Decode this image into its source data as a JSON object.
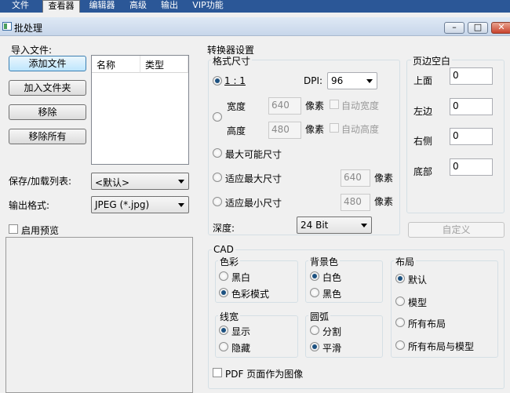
{
  "menu": {
    "items": [
      "文件",
      "查看器",
      "编辑器",
      "高级",
      "输出",
      "VIP功能"
    ],
    "active_index": 1
  },
  "window": {
    "title": "批处理",
    "min": "–",
    "max": "□",
    "close": "✕"
  },
  "import": {
    "label": "导入文件:",
    "add_files": "添加文件",
    "add_folder": "加入文件夹",
    "remove": "移除",
    "remove_all": "移除所有",
    "columns": [
      "名称",
      "类型"
    ]
  },
  "save_load": {
    "label": "保存/加载列表:",
    "value": "<默认>"
  },
  "output_format": {
    "label": "输出格式:",
    "value": "JPEG (*.jpg)"
  },
  "preview": {
    "label": "启用预览",
    "checked": false
  },
  "converter": {
    "title": "转换器设置",
    "format_size": {
      "title": "格式尺寸",
      "one_to_one": "1 : 1",
      "dpi_label": "DPI:",
      "dpi_value": "96",
      "width_label": "宽度",
      "width_value": "640",
      "height_label": "高度",
      "height_value": "480",
      "pixel_label": "像素",
      "auto_width": "自动宽度",
      "auto_height": "自动高度",
      "max_possible": "最大可能尺寸",
      "fit_max": "适应最大尺寸",
      "fit_max_value": "640",
      "fit_min": "适应最小尺寸",
      "fit_min_value": "480",
      "depth_label": "深度:",
      "depth_value": "24 Bit"
    },
    "margins": {
      "title": "页边空白",
      "top_label": "上面",
      "top_value": "0",
      "left_label": "左边",
      "left_value": "0",
      "right_label": "右侧",
      "right_value": "0",
      "bottom_label": "底部",
      "bottom_value": "0",
      "custom": "自定义"
    },
    "cad": {
      "title": "CAD",
      "color": {
        "title": "色彩",
        "bw": "黑白",
        "color_mode": "色彩模式",
        "selected": "color_mode"
      },
      "background": {
        "title": "背景色",
        "white": "白色",
        "black": "黑色",
        "selected": "white"
      },
      "layout": {
        "title": "布局",
        "default": "默认",
        "model": "模型",
        "all_layouts": "所有布局",
        "all_layouts_model": "所有布局与模型",
        "selected": "default"
      },
      "line_width": {
        "title": "线宽",
        "show": "显示",
        "hide": "隐藏",
        "selected": "show"
      },
      "arc": {
        "title": "圆弧",
        "split": "分割",
        "smooth": "平滑",
        "selected": "smooth"
      },
      "pdf_as_image": "PDF 页面作为图像"
    }
  }
}
